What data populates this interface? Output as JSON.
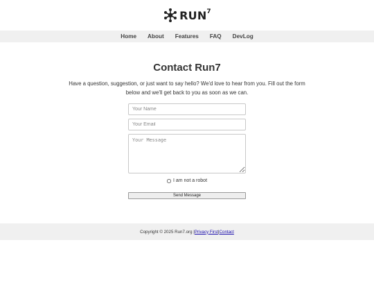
{
  "brand": {
    "name": "RUN",
    "superscript": "7"
  },
  "nav": {
    "items": [
      "Home",
      "About",
      "Features",
      "FAQ",
      "DevLog"
    ]
  },
  "main": {
    "title": "Contact Run7",
    "intro": "Have a question, suggestion, or just want to say hello? We'd love to hear from you. Fill out the form below and we'll get back to you as soon as we can."
  },
  "form": {
    "name_placeholder": "Your Name",
    "email_placeholder": "Your Email",
    "message_placeholder": "Your Message",
    "robot_label": "I am not a robot",
    "robot_checked": false,
    "send_label": "Send Message"
  },
  "footer": {
    "copyright": "Copyright © 2025 Run7.org | ",
    "privacy_label": "Privacy First",
    "separator": " | ",
    "contact_label": "Contact"
  },
  "icons": {
    "logo": "molecule-icon"
  },
  "colors": {
    "nav_bg": "#f0f0f0",
    "footer_bg": "#f0f0f0",
    "link": "#1a0dab"
  }
}
